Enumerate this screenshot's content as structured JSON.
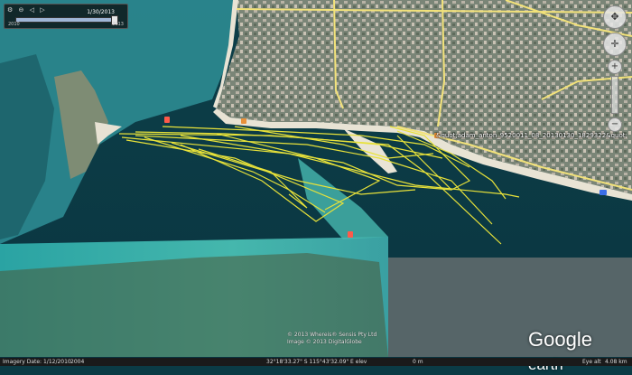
{
  "time_slider": {
    "current_date": "1/30/2013",
    "start_label": "2010",
    "end_label": "2013",
    "value": 0.99
  },
  "track": {
    "label": "&quot;adam_anton_9520011_08_20130130_1829322&quot;",
    "color": "#e8e23a"
  },
  "marker": {
    "color": "#ff5a4a",
    "icon": "placemark-icon"
  },
  "copyright": {
    "line1": "© 2013 Whereis® Sensis Pty Ltd",
    "line2": "Image © 2013 DigitalGlobe"
  },
  "logo": {
    "google": "Google",
    "earth": "earth"
  },
  "status": {
    "imagery_date": "Imagery Date: 1/12/2010",
    "year": "2004",
    "coords": "32°18'33.27\" S 115°43'32.09\" E  elev",
    "elev": "0 m",
    "eye_alt_label": "Eye alt",
    "eye_alt": "4.08 km"
  },
  "colors": {
    "deep_water": "#0f4650",
    "shallow_water": "#3fb3b0",
    "land": "#7d8a7a",
    "beach": "#e9e6da",
    "road": "#f3e47a"
  }
}
